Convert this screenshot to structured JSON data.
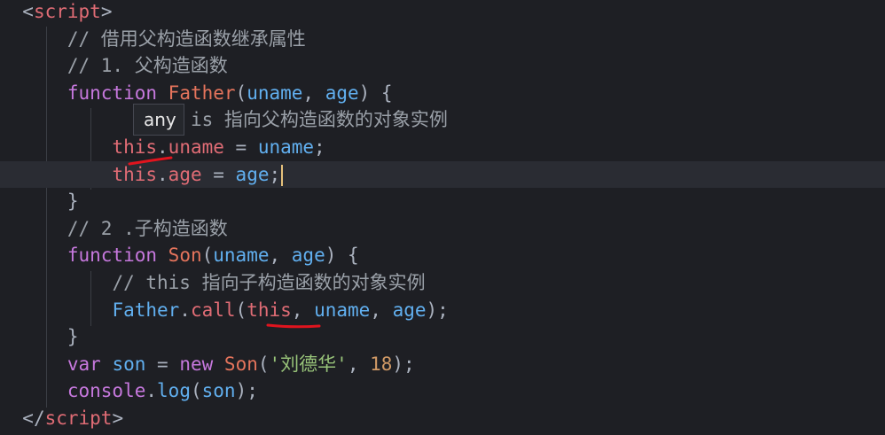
{
  "code": {
    "open_tag": [
      "<",
      "script",
      ">"
    ],
    "comment_inherit": "// 借用父构造函数继承属性",
    "comment_father": "// 1. 父构造函数",
    "father_fn": {
      "keyword": "function",
      "name": "Father",
      "open": "(",
      "p1": "uname",
      "sep": ", ",
      "p2": "age",
      "close": ") {"
    },
    "comment_this_father_tail": "is 指向父构造函数的对象实例",
    "assign_uname": {
      "this": "this",
      "dot": ".",
      "prop": "uname",
      "eq": " = ",
      "val": "uname",
      "end": ";"
    },
    "assign_age": {
      "this": "this",
      "dot": ".",
      "prop": "age",
      "eq": " = ",
      "val": "age",
      "end": ";"
    },
    "close_brace": "}",
    "comment_son": "// 2 .子构造函数",
    "son_fn": {
      "keyword": "function",
      "name": "Son",
      "open": "(",
      "p1": "uname",
      "sep": ", ",
      "p2": "age",
      "close": ") {"
    },
    "comment_this_son": "// this 指向子构造函数的对象实例",
    "call_line": {
      "obj": "Father",
      "dot": ".",
      "method": "call",
      "open": "(",
      "this": "this",
      "sep1": ", ",
      "a1": "uname",
      "sep2": ", ",
      "a2": "age",
      "end": ");"
    },
    "close_brace2": "}",
    "var_line": {
      "kw": "var",
      "name": "son",
      "eq": " = ",
      "new": "new",
      "ctor": "Son",
      "open": "(",
      "str": "'刘德华'",
      "sep": ", ",
      "num": "18",
      "end": ");"
    },
    "console_line": {
      "obj": "console",
      "dot": ".",
      "method": "log",
      "open": "(",
      "arg": "son",
      "end": ");"
    },
    "close_tag": [
      "</",
      "script",
      ">"
    ]
  },
  "tooltip": {
    "text": "any"
  },
  "colors": {
    "background": "#1e1f24",
    "keyword": "#c678dd",
    "this": "#e06c75",
    "param": "#61afef",
    "comment": "#9aa0a8",
    "annotation": "#e0141e"
  }
}
